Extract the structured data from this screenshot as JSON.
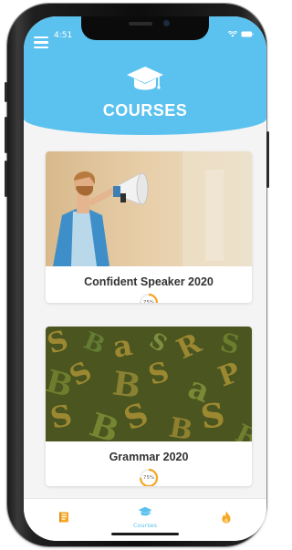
{
  "status_bar": {
    "time": "4:51"
  },
  "header": {
    "title": "COURSES",
    "icon": "graduation-cap-icon"
  },
  "courses": [
    {
      "title": "Confident Speaker 2020",
      "progress_label": "75%",
      "progress": 0.75
    },
    {
      "title": "Grammar 2020",
      "progress_label": "75%",
      "progress": 0.75
    }
  ],
  "tab_bar": {
    "tabs": [
      {
        "icon": "book-icon",
        "label": ""
      },
      {
        "icon": "graduation-cap-icon",
        "label": "Courses"
      },
      {
        "icon": "flame-icon",
        "label": ""
      }
    ]
  },
  "colors": {
    "accent": "#5bc2ef",
    "progress": "#f5a623",
    "tab_inactive": "#f5a623"
  }
}
